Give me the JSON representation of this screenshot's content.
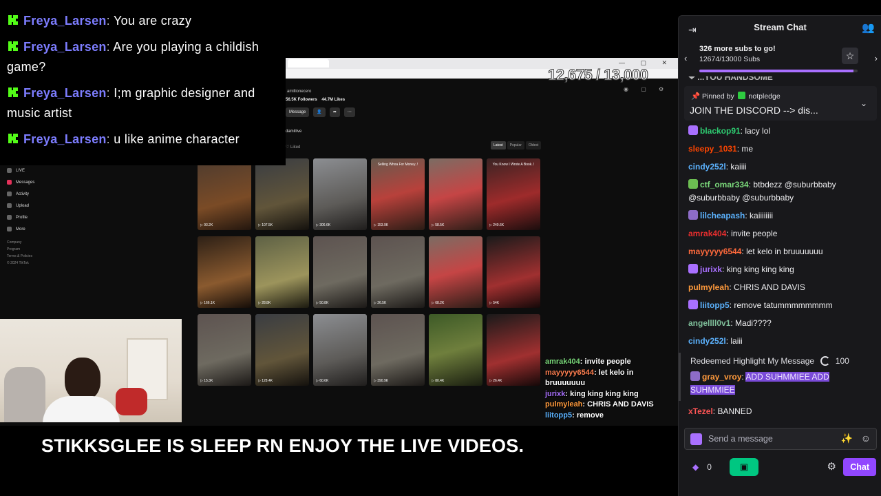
{
  "overlay_chat": [
    {
      "user": "Freya_Larsen",
      "text": "You are crazy"
    },
    {
      "user": "Freya_Larsen",
      "text": "Are you playing a childish game?"
    },
    {
      "user": "Freya_Larsen",
      "text": "I;m graphic designer and music artist"
    },
    {
      "user": "Freya_Larsen",
      "text": "u like anime character"
    }
  ],
  "stream": {
    "sub_overlay": "12,675 / 13,000",
    "banner": "STIKKSGLEE IS SLEEP RN ENJOY THE LIVE VIDEOS.",
    "site": {
      "nav": [
        "LIVE",
        "Messages",
        "Activity",
        "Upload",
        "Profile",
        "More"
      ],
      "footer": [
        "Company",
        "Program",
        "Terms & Policies",
        "© 2024 TikTok"
      ],
      "username": "amillionecero",
      "followers": "56.5K Followers",
      "likes": "44.7M Likes",
      "btn_message": "Message",
      "handle": "damillive",
      "liked_tab": "Liked",
      "sort": [
        "Latest",
        "Popular",
        "Oldest"
      ]
    },
    "videos": [
      {
        "title": "",
        "views": "93.2K",
        "c": "c1"
      },
      {
        "title": "",
        "views": "107.5K",
        "c": "c2"
      },
      {
        "title": "",
        "views": "306.6K",
        "c": "c3"
      },
      {
        "title": "Selling Whoa For Money..!",
        "views": "153.9K",
        "c": "c4"
      },
      {
        "title": "",
        "views": "58.5K",
        "c": "c5"
      },
      {
        "title": "You Know I Wrote A Book..!",
        "views": "240.6K",
        "c": "c6"
      },
      {
        "title": "",
        "views": "166.1K",
        "c": "c7"
      },
      {
        "title": "",
        "views": "28.8K",
        "c": "c8"
      },
      {
        "title": "",
        "views": "50.8K",
        "c": "c9"
      },
      {
        "title": "",
        "views": "26.5K",
        "c": "c9"
      },
      {
        "title": "",
        "views": "68.2K",
        "c": "c5"
      },
      {
        "title": "",
        "views": "54K",
        "c": "c11"
      },
      {
        "title": "",
        "views": "15.3K",
        "c": "c9"
      },
      {
        "title": "",
        "views": "128.4K",
        "c": "c2"
      },
      {
        "title": "",
        "views": "60.6K",
        "c": "c3"
      },
      {
        "title": "",
        "views": "390.9K",
        "c": "c9"
      },
      {
        "title": "",
        "views": "80.4K",
        "c": "c10"
      },
      {
        "title": "",
        "views": "26.4K",
        "c": "c11"
      }
    ],
    "mini_chat": [
      {
        "user": "amrak404",
        "text": "invite people",
        "color": "#7cdb7c"
      },
      {
        "user": "mayyyyy6544",
        "text": "let kelo in bruuuuuuu",
        "color": "#ff7f50"
      },
      {
        "user": "jurixk",
        "text": "king king king king",
        "color": "#a970ff"
      },
      {
        "user": "pulmyleah",
        "text": "CHRIS AND DAVIS",
        "color": "#ff9a3c"
      },
      {
        "user": "liitopp5",
        "text": "remove",
        "color": "#5cb3ff"
      }
    ]
  },
  "chat": {
    "title": "Stream Chat",
    "goal_line1": "326 more subs to go!",
    "goal_line2": "12674/13000 Subs",
    "goal_progress": 0.975,
    "pinned_by_label": "Pinned by",
    "pinned_by_user": "notpledge",
    "pinned_text": "JOIN THE DISCORD --> dis...",
    "pinned_behind": "❤ ...YOU HANDSOME",
    "messages": [
      {
        "user": "blackop91",
        "text": "lacy lol",
        "color": "#2ecc71",
        "badge": "#a970ff"
      },
      {
        "user": "sleepy_1031",
        "text": "me",
        "color": "#ff4500",
        "badge": ""
      },
      {
        "user": "cindy252l",
        "text": "kaiiii",
        "color": "#5cb3ff",
        "badge": ""
      },
      {
        "user": "ctf_omar334",
        "text": "btbdezz @suburbbaby @suburbbaby @suburbbaby",
        "color": "#7cdb7c",
        "badge": "#6cbd52"
      },
      {
        "user": "lilcheapash",
        "text": "kaiiiiiiii",
        "color": "#5cb3ff",
        "badge": "#8d6cc8"
      },
      {
        "user": "amrak404",
        "text": "invite people",
        "color": "#e62e2e",
        "badge": ""
      },
      {
        "user": "mayyyyy6544",
        "text": "let kelo in bruuuuuuu",
        "color": "#ff6a3c",
        "badge": ""
      },
      {
        "user": "jurixk",
        "text": "king king king king",
        "color": "#a970ff",
        "badge": "#a970ff"
      },
      {
        "user": "pulmyleah",
        "text": "CHRIS AND DAVIS",
        "color": "#ff9a3c",
        "badge": ""
      },
      {
        "user": "liitopp5",
        "text": "remove tatummmmmmmm",
        "color": "#5cb3ff",
        "badge": "#a970ff"
      },
      {
        "user": "angellll0v1",
        "text": "Madi????",
        "color": "#7fbf9a",
        "badge": ""
      },
      {
        "user": "cindy252l",
        "text": "laiii",
        "color": "#5cb3ff",
        "badge": ""
      }
    ],
    "highlight_label": "Redeemed Highlight My Message",
    "highlight_points": "100",
    "highlight_user": "gray_vroy",
    "highlight_text": "ADD SUHMMIEE ADD SUHMMIEE",
    "banned_user": "xTezel",
    "banned_text": "BANNED",
    "input_placeholder": "Send a message",
    "bits_count": "0",
    "send_label": "Chat"
  }
}
